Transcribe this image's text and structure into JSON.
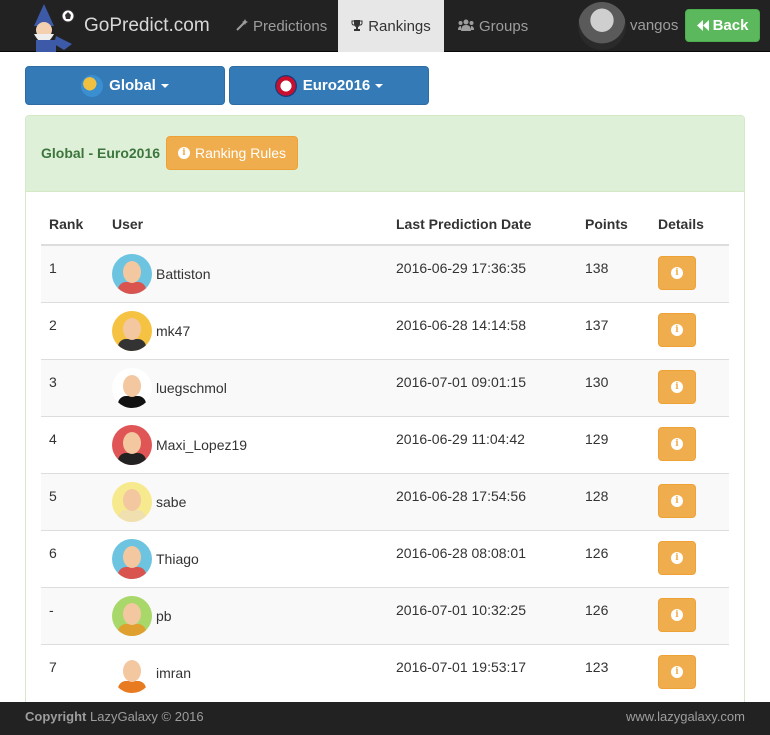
{
  "navbar": {
    "brand": "GoPredict.com",
    "items": [
      {
        "label": "Predictions",
        "icon": "magic-wand-icon"
      },
      {
        "label": "Rankings",
        "icon": "trophy-icon",
        "active": true
      },
      {
        "label": "Groups",
        "icon": "users-icon"
      }
    ],
    "username": "vangos",
    "back_label": "Back"
  },
  "filters": {
    "scope": "Global",
    "tournament": "Euro2016"
  },
  "panel": {
    "title": "Global - Euro2016",
    "rules_label": "Ranking Rules"
  },
  "table": {
    "headers": [
      "Rank",
      "User",
      "Last Prediction Date",
      "Points",
      "Details"
    ],
    "rows": [
      {
        "rank": "1",
        "user": "Battiston",
        "date": "2016-06-29 17:36:35",
        "points": "138",
        "avatar_bg": "#6cc4e0",
        "avatar_body": "#d9534f"
      },
      {
        "rank": "2",
        "user": "mk47",
        "date": "2016-06-28 14:14:58",
        "points": "137",
        "avatar_bg": "#f5c242",
        "avatar_body": "#333333"
      },
      {
        "rank": "3",
        "user": "luegschmol",
        "date": "2016-07-01 09:01:15",
        "points": "130",
        "avatar_bg": "#ffffff",
        "avatar_body": "#111111"
      },
      {
        "rank": "4",
        "user": "Maxi_Lopez19",
        "date": "2016-06-29 11:04:42",
        "points": "129",
        "avatar_bg": "#e05555",
        "avatar_body": "#222222"
      },
      {
        "rank": "5",
        "user": "sabe",
        "date": "2016-06-28 17:54:56",
        "points": "128",
        "avatar_bg": "#f7e98e",
        "avatar_body": "#f0e0b0"
      },
      {
        "rank": "6",
        "user": "Thiago",
        "date": "2016-06-28 08:08:01",
        "points": "126",
        "avatar_bg": "#6cc4e0",
        "avatar_body": "#d9534f"
      },
      {
        "rank": "-",
        "user": "pb",
        "date": "2016-07-01 10:32:25",
        "points": "126",
        "avatar_bg": "#a8d86a",
        "avatar_body": "#e0a030"
      },
      {
        "rank": "7",
        "user": "imran",
        "date": "2016-07-01 19:53:17",
        "points": "123",
        "avatar_bg": "#ffffff",
        "avatar_body": "#e87a20"
      }
    ]
  },
  "footer": {
    "copyright_prefix": "Copyright",
    "copyright_rest": " LazyGalaxy © 2016",
    "site": "www.lazygalaxy.com"
  },
  "colors": {
    "navbar": "#222222",
    "primary": "#337ab7",
    "warning": "#f0ad4e",
    "success": "#5cb85c",
    "panel_heading": "#dff0d8"
  }
}
